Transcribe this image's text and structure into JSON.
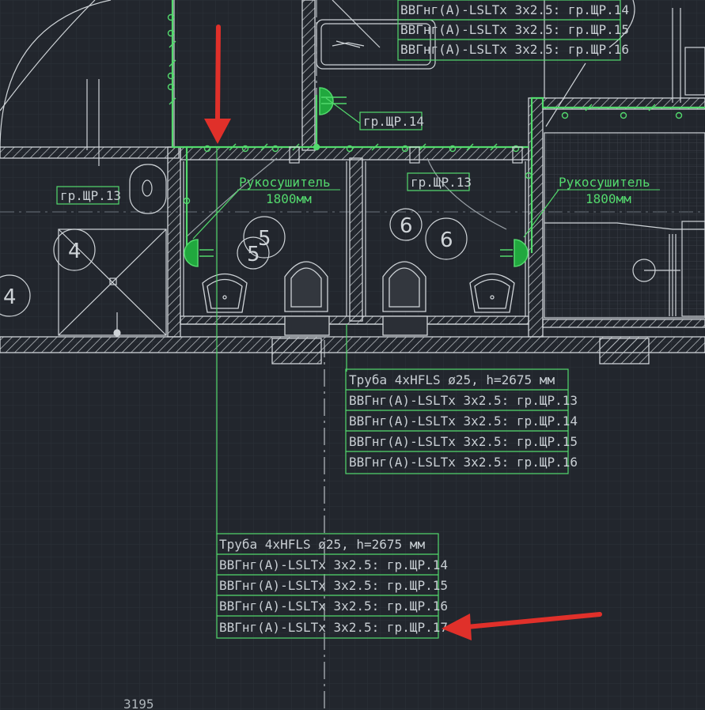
{
  "top_cable_labels": [
    "ВВГнг(А)-LSLTx 3х2.5: гр.ЩР.14",
    "ВВГнг(А)-LSLTx 3х2.5: гр.ЩР.15",
    "ВВГнг(А)-LSLTx 3х2.5: гр.ЩР.16"
  ],
  "group_labels": {
    "left": "гр.ЩР.13",
    "middle_top": "гр.ЩР.14",
    "middle": "гр.ЩР.13"
  },
  "hand_dryer": {
    "name": "Рукосушитель",
    "height": "1800мм"
  },
  "room_numbers": {
    "left_a": "4",
    "left_b": "4",
    "mid_a": "5",
    "mid_b": "5",
    "right_a": "6",
    "right_b": "6"
  },
  "callout_middle": [
    "Труба 4хHFLS ø25, h=2675 мм",
    "ВВГнг(А)-LSLTx 3х2.5: гр.ЩР.13",
    "ВВГнг(А)-LSLTx 3х2.5: гр.ЩР.14",
    "ВВГнг(А)-LSLTx 3х2.5: гр.ЩР.15",
    "ВВГнг(А)-LSLTx 3х2.5: гр.ЩР.16"
  ],
  "callout_bottom": [
    "Труба 4хHFLS ø25, h=2675 мм",
    "ВВГнг(А)-LSLTx 3х2.5: гр.ЩР.14",
    "ВВГнг(А)-LSLTx 3х2.5: гр.ЩР.15",
    "ВВГнг(А)-LSLTx 3х2.5: гр.ЩР.16",
    "ВВГнг(А)-LSLTx 3х2.5: гр.ЩР.17"
  ],
  "dimension": "3195",
  "colors": {
    "background": "#22262d",
    "wire": "#53d96d",
    "annotation_arrow": "#e0302a",
    "linework": "#cfd4d8"
  }
}
